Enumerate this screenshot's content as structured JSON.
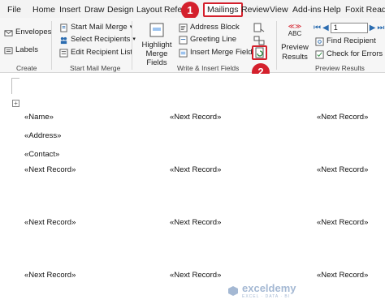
{
  "menu": {
    "tabs": [
      "File",
      "Home",
      "Insert",
      "Draw",
      "Design",
      "Layout",
      "Refe",
      "Mailings",
      "Review",
      "View",
      "Add-ins",
      "Help",
      "Foxit Reade"
    ]
  },
  "ribbon": {
    "create": {
      "envelopes": "Envelopes",
      "labels": "Labels",
      "group": "Create"
    },
    "start_mail_merge": {
      "start": "Start Mail Merge",
      "select": "Select Recipients",
      "edit": "Edit Recipient List",
      "group": "Start Mail Merge"
    },
    "write_insert": {
      "highlight_line1": "Highlight",
      "highlight_line2": "Merge Fields",
      "address": "Address Block",
      "greeting": "Greeting Line",
      "insert_field": "Insert Merge Field",
      "group": "Write & Insert Fields"
    },
    "preview": {
      "abc": "ABC",
      "preview_line1": "Preview",
      "preview_line2": "Results",
      "record_value": "1",
      "find": "Find Recipient",
      "check": "Check for Errors",
      "group": "Preview Results"
    }
  },
  "callouts": [
    "1",
    "2"
  ],
  "document": {
    "col1": [
      "«Name»",
      "«Address»",
      "«Contact»",
      "«Next Record»",
      "«Next Record»",
      "«Next Record»"
    ],
    "col2": [
      "«Next Record»",
      "«Next Record»",
      "«Next Record»",
      "«Next Record»"
    ],
    "col3": [
      "«Next Record»",
      "«Next Record»",
      "«Next Record»",
      "«Next Record»"
    ]
  },
  "watermark": {
    "brand": "exceldemy",
    "tagline": "EXCEL · DATA · BI"
  },
  "colors": {
    "callout": "#d4202c",
    "accent_blue": "#2b6cb0"
  }
}
